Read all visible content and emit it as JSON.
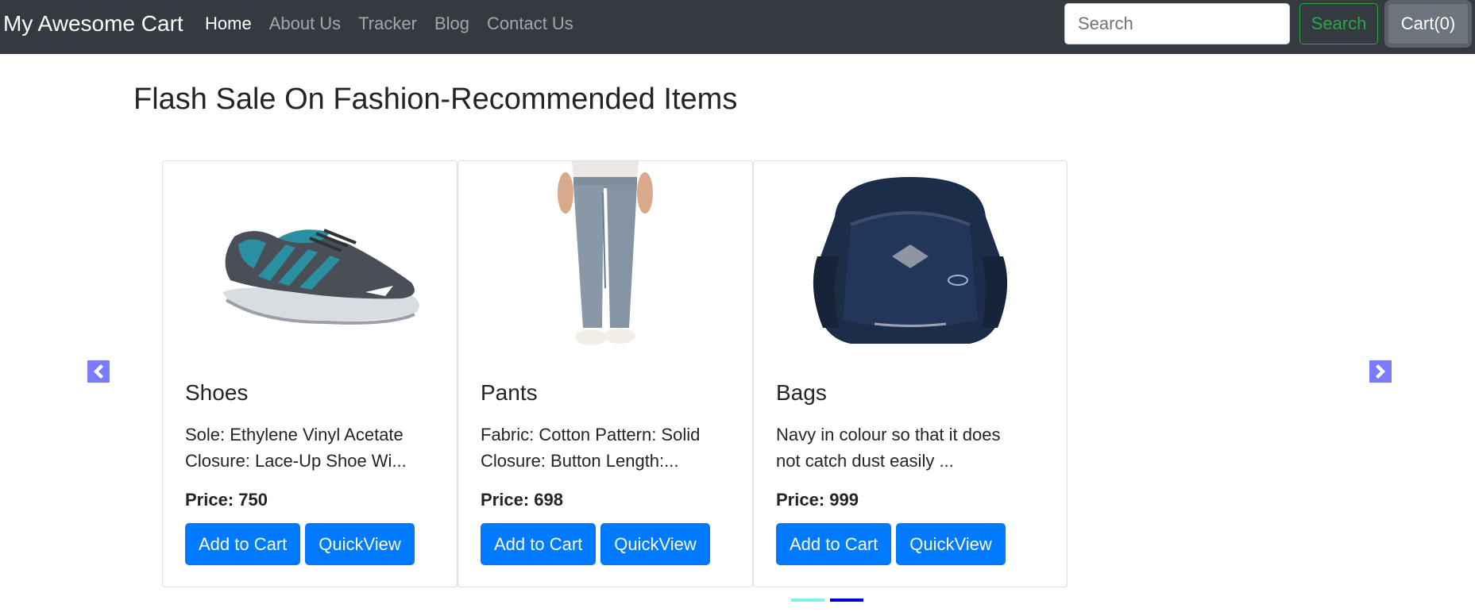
{
  "navbar": {
    "brand": "My Awesome Cart",
    "links": [
      {
        "label": "Home",
        "active": true
      },
      {
        "label": "About Us",
        "active": false
      },
      {
        "label": "Tracker",
        "active": false
      },
      {
        "label": "Blog",
        "active": false
      },
      {
        "label": "Contact Us",
        "active": false
      }
    ],
    "search_placeholder": "Search",
    "search_button": "Search",
    "cart_button": "Cart(0)"
  },
  "heading": "Flash Sale On Fashion-Recommended Items",
  "carousel": {
    "prev_icon": "chevron-left-icon",
    "next_icon": "chevron-right-icon",
    "indicator_colors": {
      "active": "#7ff0f0",
      "inactive": "#0000cc"
    },
    "cards": [
      {
        "title": "Shoes",
        "description": "Sole: Ethylene Vinyl Acetate Closure: Lace-Up Shoe Wi...",
        "price": "Price: 750",
        "add_label": "Add to Cart",
        "quickview_label": "QuickView",
        "image": "running-shoe-image"
      },
      {
        "title": "Pants",
        "description": "Fabric: Cotton Pattern: Solid Closure: Button Length:...",
        "price": "Price: 698",
        "add_label": "Add to Cart",
        "quickview_label": "QuickView",
        "image": "grey-pants-image"
      },
      {
        "title": "Bags",
        "description": "Navy in colour so that it does not catch dust easily ...",
        "price": "Price: 999",
        "add_label": "Add to Cart",
        "quickview_label": "QuickView",
        "image": "navy-backpack-image"
      }
    ]
  },
  "colors": {
    "navbar_bg": "#343a40",
    "primary": "#007bff",
    "success": "#28a745",
    "secondary": "#6c757d"
  }
}
